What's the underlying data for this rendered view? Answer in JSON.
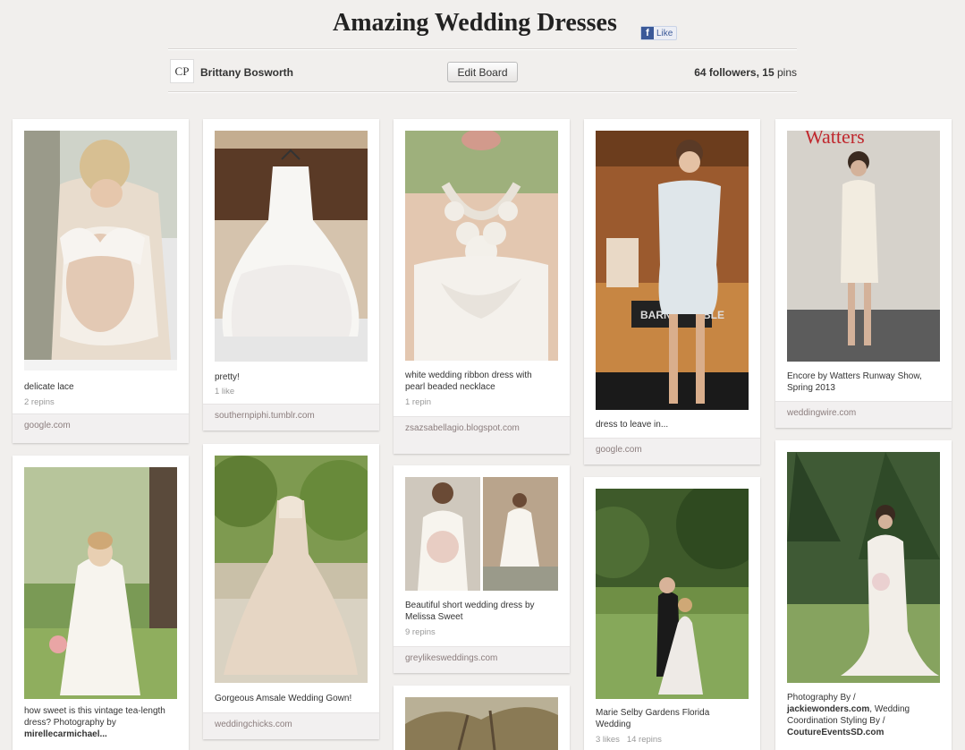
{
  "board": {
    "title": "Amazing Wedding Dresses",
    "like_label": "Like",
    "owner": "Brittany Bosworth",
    "avatar_initials": "CP",
    "edit_label": "Edit Board",
    "followers": "64 followers, ",
    "pins": "15",
    "pins_suffix": " pins"
  },
  "pins": [
    {
      "desc": "delicate lace",
      "meta": "2 repins",
      "source": "google.com"
    },
    {
      "desc": "pretty!",
      "meta": "1 like",
      "source": "southernpiphi.tumblr.com"
    },
    {
      "desc": "white wedding ribbon dress with pearl beaded necklace",
      "meta": "1 repin",
      "source": "zsazsabellagio.blogspot.com"
    },
    {
      "desc": "dress to leave in...",
      "meta": "",
      "source": "google.com"
    },
    {
      "desc": "Encore by Watters Runway Show, Spring 2013",
      "meta": "",
      "source": "weddingwire.com"
    },
    {
      "desc": "how sweet is this vintage tea-length dress? Photography by",
      "desc_bold": "mirellecarmichael...",
      "meta": "",
      "source": ""
    },
    {
      "desc": "Gorgeous Amsale Wedding Gown!",
      "meta": "",
      "source": "weddingchicks.com"
    },
    {
      "desc": "Beautiful short wedding dress by Melissa Sweet",
      "meta": "9 repins",
      "source": "greylikesweddings.com"
    },
    {
      "desc": "Marie Selby Gardens Florida Wedding",
      "meta": "3 likes   14 repins",
      "source": ""
    },
    {
      "desc": "Photography By /",
      "desc_bold": "jackiewonders.com",
      "desc2": ", Wedding Coordination Styling By /",
      "desc_bold2": "CoutureEventsSD.com",
      "meta": "",
      "source": ""
    }
  ],
  "image_text": {
    "watters": "Watters",
    "barnes": "BARN",
    "barnes2": "BLE"
  },
  "colors": {
    "background": "#f1efed",
    "source_bar": "#f2f0f0",
    "facebook": "#3b5998"
  }
}
